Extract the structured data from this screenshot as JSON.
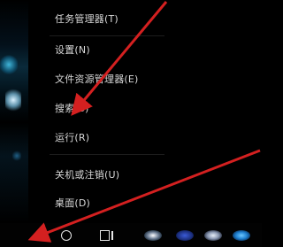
{
  "context_menu": {
    "items": [
      {
        "label": "任务管理器(T)"
      },
      {
        "label": "设置(N)"
      },
      {
        "label": "文件资源管理器(E)"
      },
      {
        "label": "搜索(S)"
      },
      {
        "label": "运行(R)"
      },
      {
        "label": "关机或注销(U)"
      },
      {
        "label": "桌面(D)"
      }
    ]
  },
  "taskbar": {
    "icons": [
      "start-icon",
      "search-icon",
      "task-view-icon",
      "app-icon",
      "app-icon",
      "app-icon",
      "app-icon"
    ]
  },
  "annotation": {
    "arrow_color": "#d42020"
  }
}
